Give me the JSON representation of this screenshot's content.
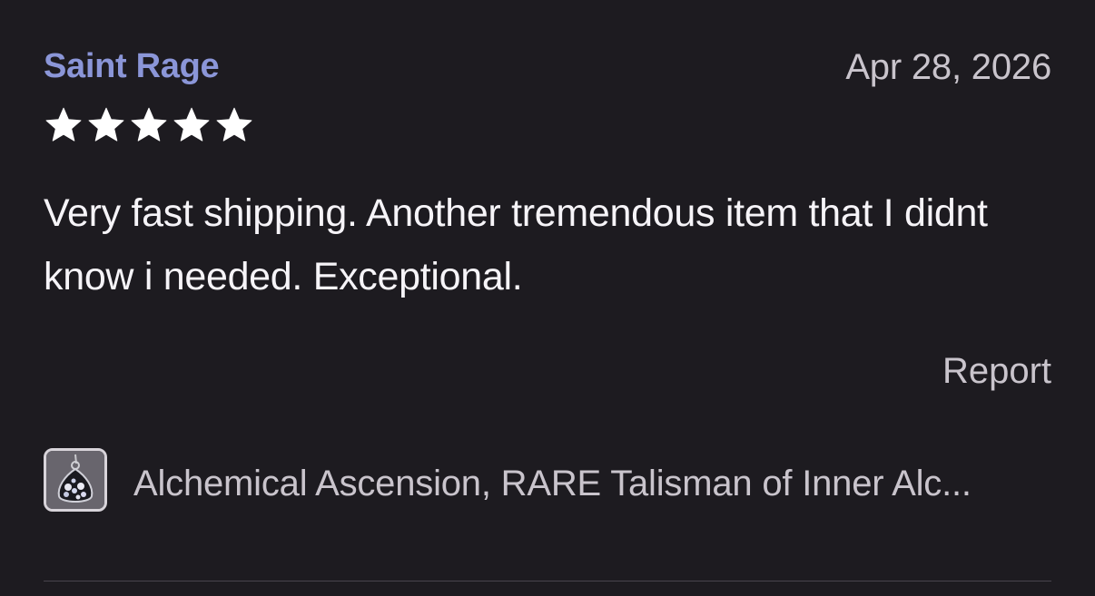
{
  "review": {
    "reviewer_name": "Saint Rage",
    "date": "Apr 28, 2026",
    "rating": 5,
    "max_rating": 5,
    "text": "Very fast shipping. Another tremendous item that I didnt know i needed. Exceptional.",
    "report_label": "Report",
    "product": {
      "title": "Alchemical Ascension, RARE Talisman of Inner Alc...",
      "thumbnail_icon": "product-thumbnail"
    }
  },
  "colors": {
    "background": "#1d1b20",
    "reviewer_name": "#8b96d8",
    "secondary_text": "#c9c4cc",
    "primary_text": "#f6f4f8",
    "star": "#ffffff"
  }
}
